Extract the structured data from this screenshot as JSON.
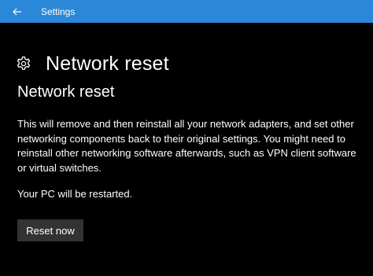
{
  "window": {
    "title": "Settings",
    "accent_color": "#2b88d8",
    "back_icon": "arrow-left-icon"
  },
  "header": {
    "icon": "gear-icon",
    "title": "Network reset"
  },
  "section": {
    "title": "Network reset",
    "description": "This will remove and then reinstall all your network adapters, and set other networking components back to their original settings. You might need to reinstall other networking software afterwards, such as VPN client software or virtual switches.",
    "restart_note": "Your PC will be restarted."
  },
  "actions": {
    "reset_label": "Reset now"
  }
}
